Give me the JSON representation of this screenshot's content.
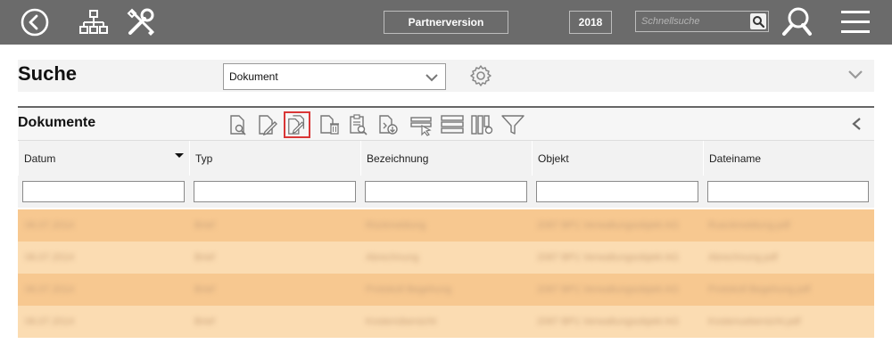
{
  "topbar": {
    "partner_label": "Partnerversion",
    "year_label": "2018",
    "quick_search_placeholder": "Schnellsuche",
    "icons": [
      "back-circle-icon",
      "sitemap-icon",
      "tools-icon",
      "magnifier-icon",
      "search-large-icon",
      "hamburger-menu-icon"
    ]
  },
  "search": {
    "title": "Suche",
    "select_value": "Dokument"
  },
  "documents": {
    "title": "Dokumente",
    "toolbar": [
      "view-document-icon",
      "edit-document-icon",
      "copy-document-icon",
      "delete-document-icon",
      "document-details-icon",
      "download-document-icon",
      "filter-select-icon",
      "list-rows-icon",
      "columns-settings-icon",
      "filter-funnel-icon"
    ],
    "active_tool": "copy-document-icon"
  },
  "table": {
    "columns": [
      "Datum",
      "Typ",
      "Bezeichnung",
      "Objekt",
      "Dateiname"
    ],
    "sorted_column": "Datum",
    "rows": [
      [
        "06.07.2014",
        "Brief",
        "Rückmeldung",
        "2087 BP1 Verwaltungsobjekt AG",
        "Rueckmeldung.pdf"
      ],
      [
        "06.07.2014",
        "Brief",
        "Abrechnung",
        "2087 BP1 Verwaltungsobjekt AG",
        "Abrechnung.pdf"
      ],
      [
        "06.07.2014",
        "Brief",
        "Protokoll Begehung",
        "2087 BP1 Verwaltungsobjekt AG",
        "Protokoll Begehung.pdf"
      ],
      [
        "06.07.2014",
        "Brief",
        "Kostenübersicht",
        "2087 BP1 Verwaltungsobjekt AG",
        "Kostenuebersicht.pdf"
      ]
    ]
  },
  "colors": {
    "topbar": "#6b6b6b",
    "row_dark": "#f7c890",
    "row_light": "#fbdcb2",
    "active_tool_border": "#d93636"
  }
}
